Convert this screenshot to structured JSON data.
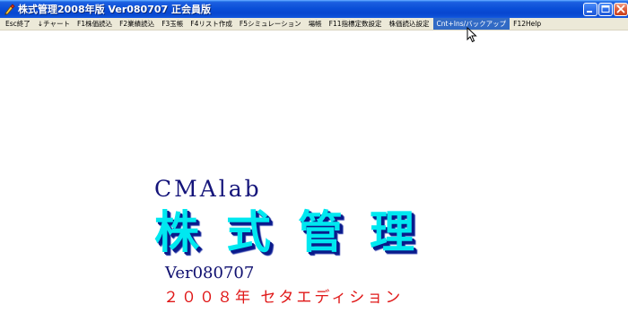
{
  "window": {
    "title": "株式管理2008年版 Ver080707 正会員版",
    "app_icon": "app-icon",
    "buttons": {
      "minimize": "minimize-icon",
      "maximize": "maximize-icon",
      "close": "close-icon"
    }
  },
  "menu": {
    "items": [
      "Esc終了",
      "↓チャート",
      "F1株価読込",
      "F2業績読込",
      "F3玉帳",
      "F4リスト作成",
      "F5シミュレーション",
      "場帳",
      "F11指標定数設定",
      "株価読込設定",
      "Cnt+Ins/バックアップ",
      "F12Help"
    ],
    "highlighted_index": 10,
    "highlight_color": "#316ac5"
  },
  "splash": {
    "brand": "CMAlab",
    "product_title": "株式管理",
    "version": "Ver080707",
    "edition": "２００８年 セタエディション"
  },
  "colors": {
    "titlebar": "#0a4fd8",
    "menubar": "#ece9d8",
    "title_text": "#00e8f0",
    "title_shadow": "#0a1a8a",
    "edition_text": "#e01818"
  },
  "cursor": "arrow-cursor-icon"
}
